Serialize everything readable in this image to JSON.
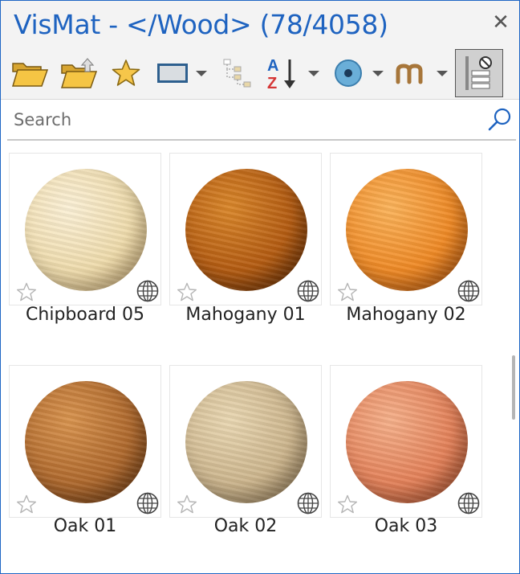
{
  "window": {
    "title": "VisMat - </Wood> (78/4058)"
  },
  "toolbar": {
    "buttons": [
      {
        "name": "open-folder-button",
        "icon": "open-folder-icon"
      },
      {
        "name": "export-folder-button",
        "icon": "folder-upload-icon"
      },
      {
        "name": "favorites-button",
        "icon": "star-icon"
      },
      {
        "name": "view-mode-button",
        "icon": "thumbnail-view-icon"
      },
      {
        "name": "tree-view-button",
        "icon": "tree-structure-icon"
      },
      {
        "name": "sort-button",
        "icon": "sort-az-icon"
      },
      {
        "name": "render-mode-button",
        "icon": "sphere-preview-icon"
      },
      {
        "name": "material-type-button",
        "icon": "material-m-icon"
      },
      {
        "name": "library-filter-button",
        "icon": "library-filter-icon",
        "active": true
      }
    ]
  },
  "search": {
    "placeholder": "Search"
  },
  "materials": [
    {
      "name": "Chipboard 05",
      "colors": [
        "#fbf0d6",
        "#efdcad",
        "#c9a870"
      ],
      "favorite": false,
      "online": true
    },
    {
      "name": "Mahogany 01",
      "colors": [
        "#d9862a",
        "#b45c12",
        "#5e2a05"
      ],
      "favorite": false,
      "online": true
    },
    {
      "name": "Mahogany 02",
      "colors": [
        "#fbb35a",
        "#ef8a26",
        "#b5540c"
      ],
      "favorite": false,
      "online": true
    },
    {
      "name": "Oak 01",
      "colors": [
        "#d8934e",
        "#b06a2e",
        "#6a3812"
      ],
      "favorite": false,
      "online": true
    },
    {
      "name": "Oak 02",
      "colors": [
        "#e9d7b2",
        "#cdb68e",
        "#8f7652"
      ],
      "favorite": false,
      "online": true
    },
    {
      "name": "Oak 03",
      "colors": [
        "#f5b08a",
        "#e4825a",
        "#a84f2c"
      ],
      "favorite": false,
      "online": true
    }
  ],
  "colors": {
    "title": "#1e63c0",
    "border": "#1f66c4",
    "search_icon": "#1e63c0"
  }
}
